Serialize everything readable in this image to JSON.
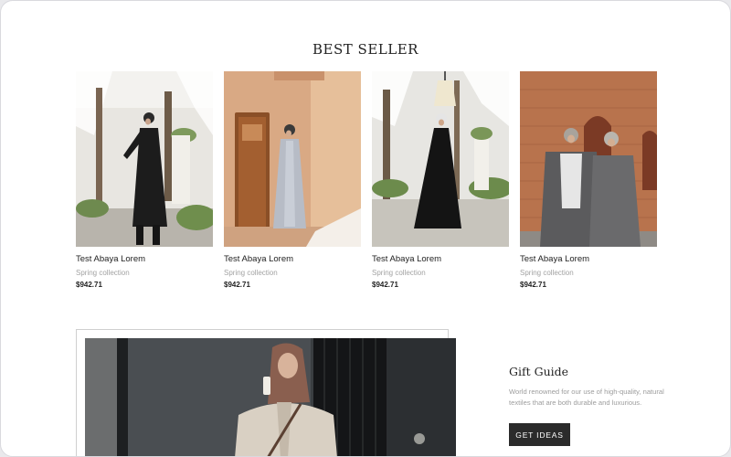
{
  "section_title": "BEST SELLER",
  "products": [
    {
      "name": "Test Abaya Lorem",
      "collection": "Spring collection",
      "price": "$942.71",
      "image": "woman in black abaya outdoors"
    },
    {
      "name": "Test Abaya Lorem",
      "collection": "Spring collection",
      "price": "$942.71",
      "image": "woman in light grey abaya by wooden door"
    },
    {
      "name": "Test Abaya Lorem",
      "collection": "Spring collection",
      "price": "$942.71",
      "image": "woman in black abaya in courtyard"
    },
    {
      "name": "Test Abaya Lorem",
      "collection": "Spring collection",
      "price": "$942.71",
      "image": "two women in grey abayas by brick wall"
    }
  ],
  "gift_guide": {
    "title": "Gift Guide",
    "description": "World renowned for our use of high-quality, natural textiles that are both durable and luxurious.",
    "button_label": "GET IDEAS"
  },
  "colors": {
    "accent": "#2b2b2b",
    "muted_text": "#a2a2a2"
  }
}
